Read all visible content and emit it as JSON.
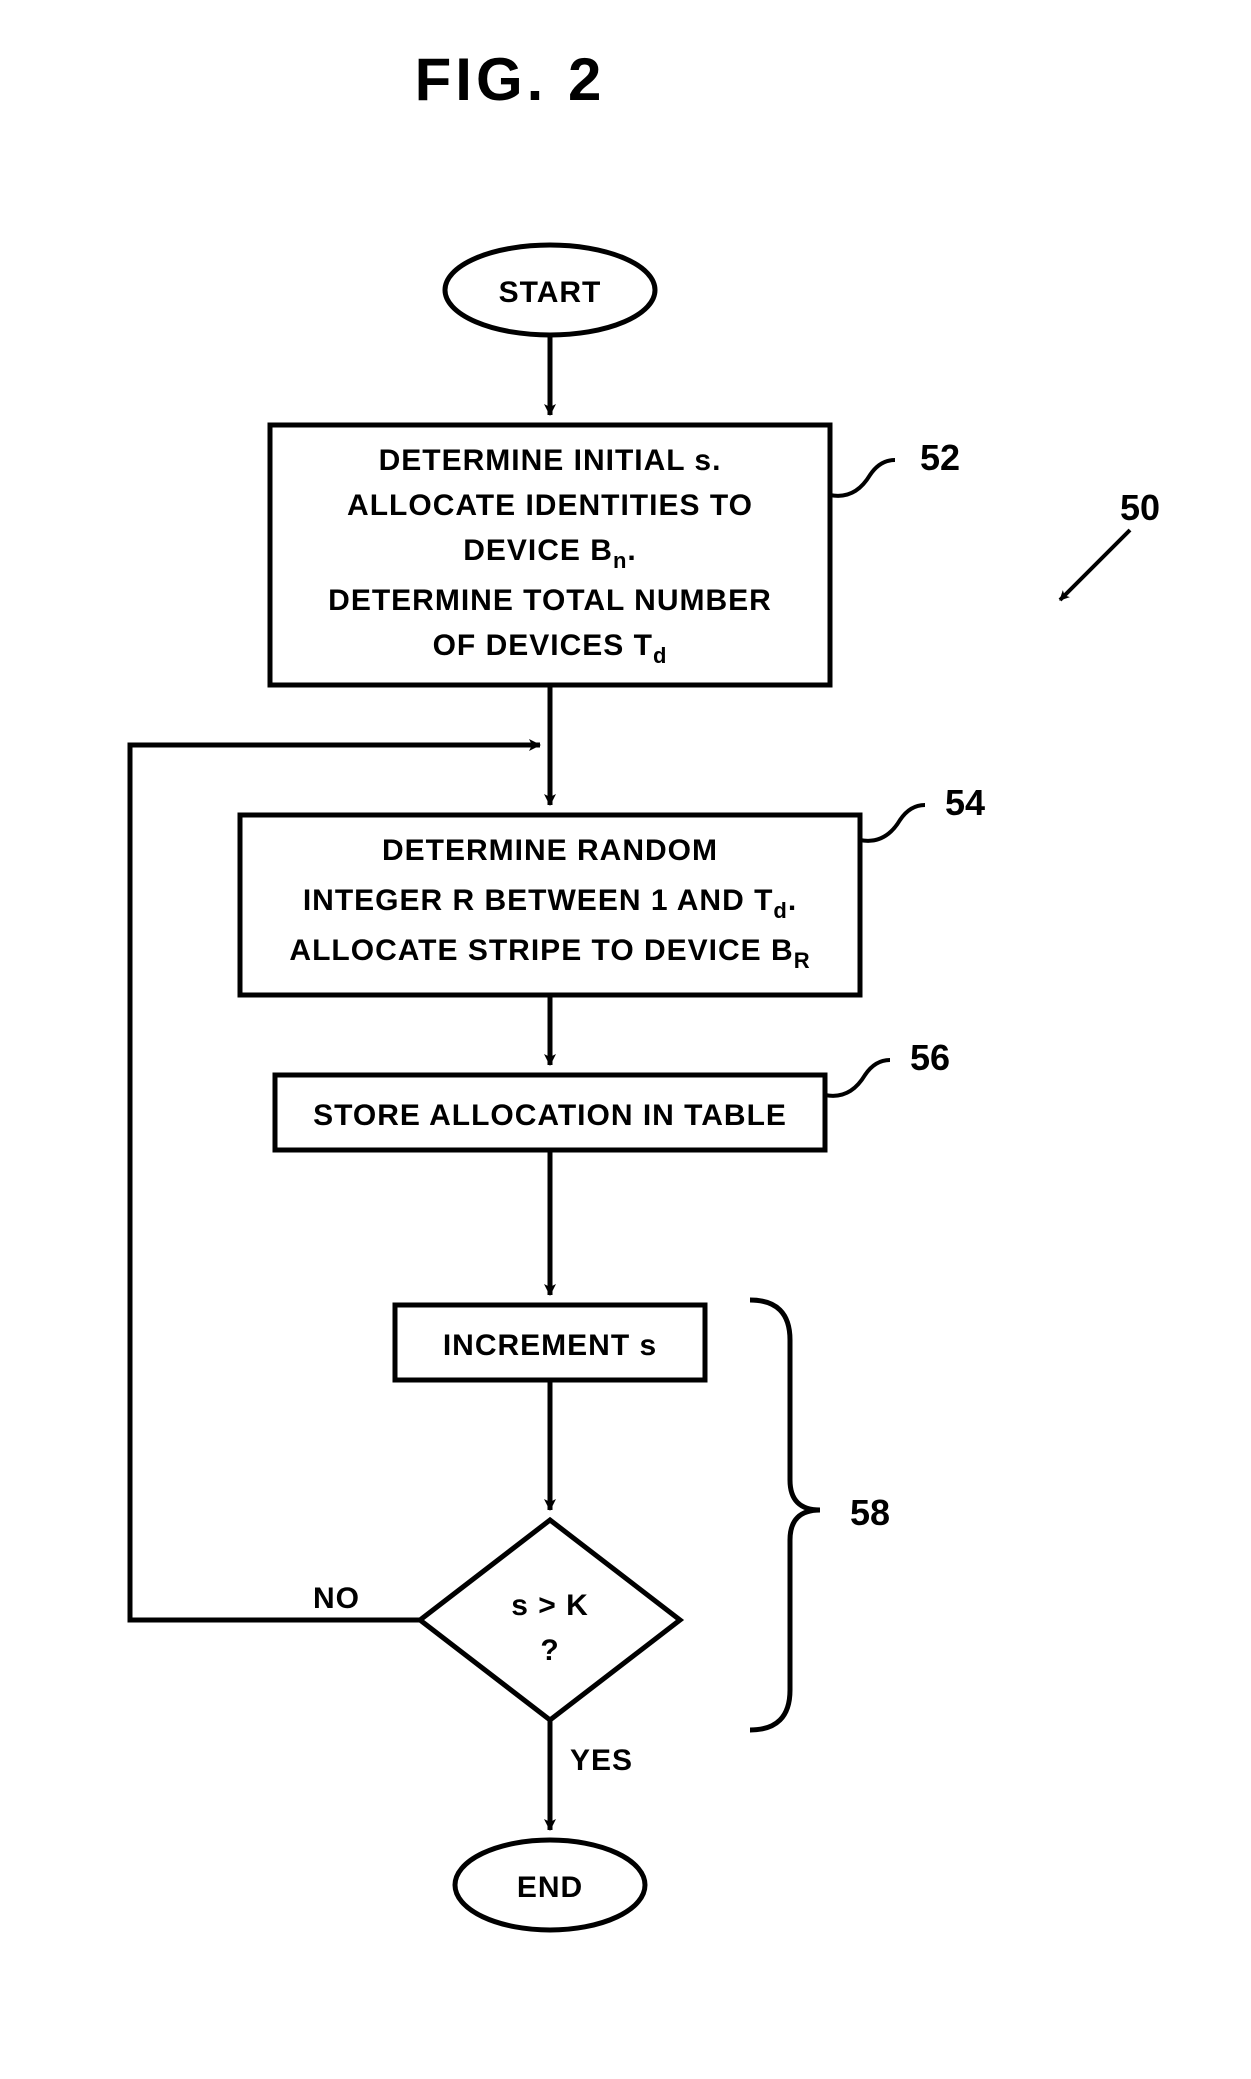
{
  "title": "FIG. 2",
  "start": "START",
  "end": "END",
  "box52_l1": "DETERMINE INITIAL s.",
  "box52_l2": "ALLOCATE IDENTITIES TO",
  "box52_l3a": "DEVICE B",
  "box52_l3b": "n",
  "box52_l3c": ".",
  "box52_l4": "DETERMINE TOTAL NUMBER",
  "box52_l5a": "OF DEVICES T",
  "box52_l5b": "d",
  "box54_l1": "DETERMINE RANDOM",
  "box54_l2a": "INTEGER R BETWEEN 1 AND T",
  "box54_l2b": "d",
  "box54_l2c": ".",
  "box54_l3a": "ALLOCATE STRIPE TO DEVICE B",
  "box54_l3b": "R",
  "box56": "STORE ALLOCATION IN TABLE",
  "box_inc": "INCREMENT s",
  "decision_l1": "s > K",
  "decision_l2": "?",
  "no": "NO",
  "yes": "YES",
  "ref50": "50",
  "ref52": "52",
  "ref54": "54",
  "ref56": "56",
  "ref58": "58",
  "chart_data": {
    "type": "flowchart",
    "nodes": [
      {
        "id": "start",
        "type": "terminator",
        "label": "START"
      },
      {
        "id": "52",
        "type": "process",
        "label": "DETERMINE INITIAL s. ALLOCATE IDENTITIES TO DEVICE B_n. DETERMINE TOTAL NUMBER OF DEVICES T_d",
        "ref": "52"
      },
      {
        "id": "54",
        "type": "process",
        "label": "DETERMINE RANDOM INTEGER R BETWEEN 1 AND T_d. ALLOCATE STRIPE TO DEVICE B_R",
        "ref": "54"
      },
      {
        "id": "56",
        "type": "process",
        "label": "STORE ALLOCATION IN TABLE",
        "ref": "56"
      },
      {
        "id": "inc",
        "type": "process",
        "label": "INCREMENT s",
        "group_ref": "58"
      },
      {
        "id": "dec",
        "type": "decision",
        "label": "s > K ?",
        "group_ref": "58"
      },
      {
        "id": "end",
        "type": "terminator",
        "label": "END"
      }
    ],
    "edges": [
      {
        "from": "start",
        "to": "52"
      },
      {
        "from": "52",
        "to": "54"
      },
      {
        "from": "54",
        "to": "56"
      },
      {
        "from": "56",
        "to": "inc"
      },
      {
        "from": "inc",
        "to": "dec"
      },
      {
        "from": "dec",
        "to": "end",
        "label": "YES"
      },
      {
        "from": "dec",
        "to": "54",
        "label": "NO"
      }
    ],
    "figure_ref": "50"
  }
}
